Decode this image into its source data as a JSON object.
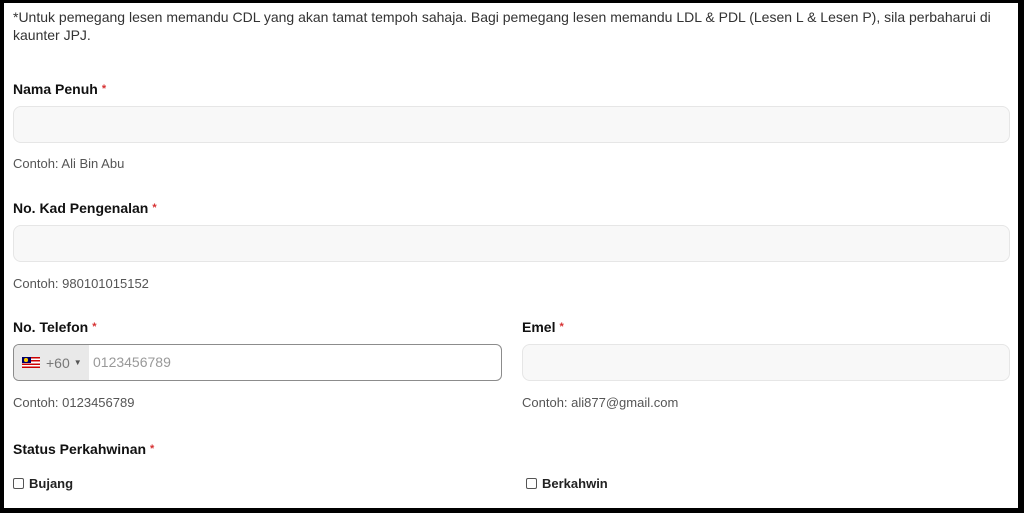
{
  "notice": "*Untuk pemegang lesen memandu CDL yang akan tamat tempoh sahaja. Bagi pemegang lesen memandu LDL & PDL (Lesen L & Lesen P), sila perbaharui di kaunter JPJ.",
  "required_mark": "*",
  "fields": {
    "name": {
      "label": "Nama Penuh",
      "value": "",
      "hint": "Contoh: Ali Bin Abu"
    },
    "ic": {
      "label": "No. Kad Pengenalan",
      "value": "",
      "hint": "Contoh: 980101015152"
    },
    "phone": {
      "label": "No. Telefon",
      "country_flag": "malaysia-flag-icon",
      "dial_code": "+60",
      "placeholder": "0123456789",
      "hint": "Contoh: 0123456789"
    },
    "email": {
      "label": "Emel",
      "value": "",
      "hint": "Contoh: ali877@gmail.com"
    },
    "marital": {
      "label": "Status Perkahwinan",
      "options": [
        {
          "label": "Bujang",
          "checked": false
        },
        {
          "label": "Berkahwin",
          "checked": false
        }
      ]
    }
  },
  "colors": {
    "required": "#d63031",
    "input_bg": "#f8f8f8",
    "dial_bg": "#e9e9e9"
  }
}
